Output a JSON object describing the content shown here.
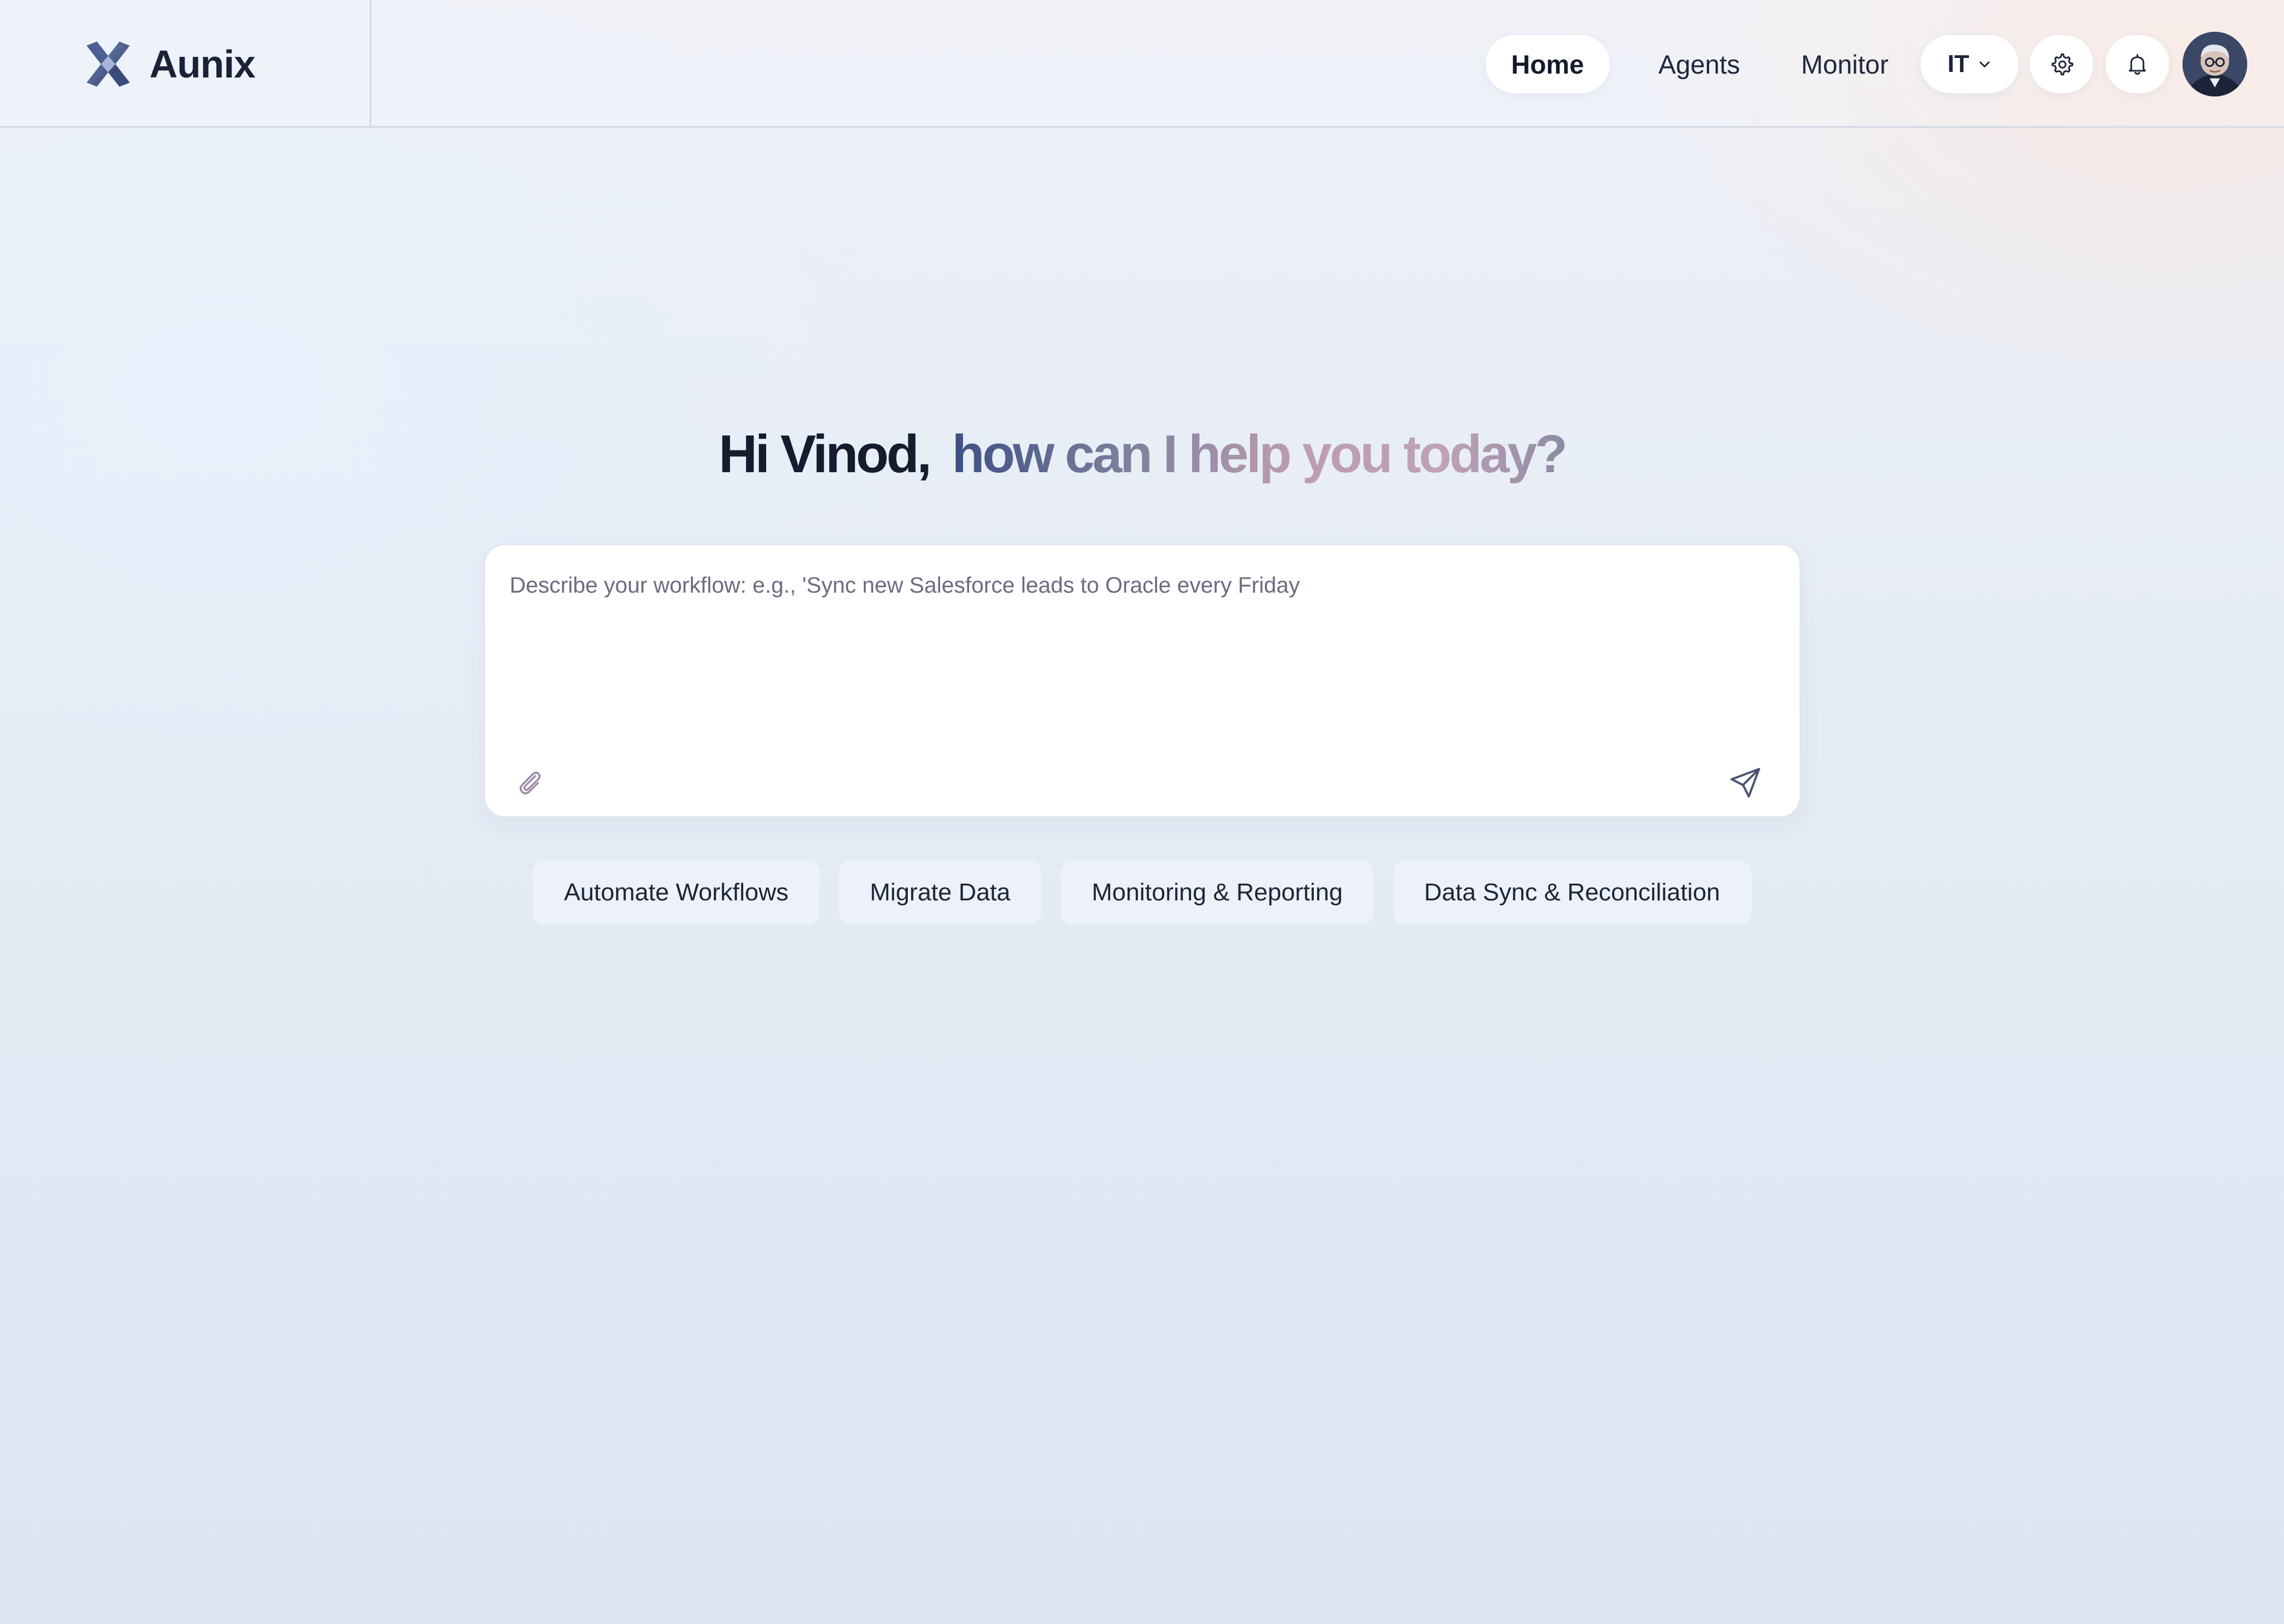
{
  "app": {
    "name": "Aunix"
  },
  "nav": {
    "items": [
      {
        "label": "Home",
        "active": true
      },
      {
        "label": "Agents",
        "active": false
      },
      {
        "label": "Monitor",
        "active": false
      }
    ],
    "department": "IT",
    "icons": [
      "chevron-down-icon",
      "gear-icon",
      "bell-icon",
      "user-avatar"
    ]
  },
  "hero": {
    "greeting": "Hi Vinod,",
    "question": "how can I help you today?"
  },
  "composer": {
    "placeholder": "Describe your workflow: e.g., 'Sync new Salesforce leads to Oracle every Friday",
    "value": "",
    "icons": [
      "paperclip-icon",
      "send-icon"
    ]
  },
  "suggestions": [
    "Automate Workflows",
    "Migrate Data",
    "Monitoring & Reporting",
    "Data Sync & Reconciliation"
  ],
  "colors": {
    "brand": "#3c4f84",
    "text": "#1b2238",
    "surface": "#ffffff",
    "chip": "#eef2fa"
  }
}
